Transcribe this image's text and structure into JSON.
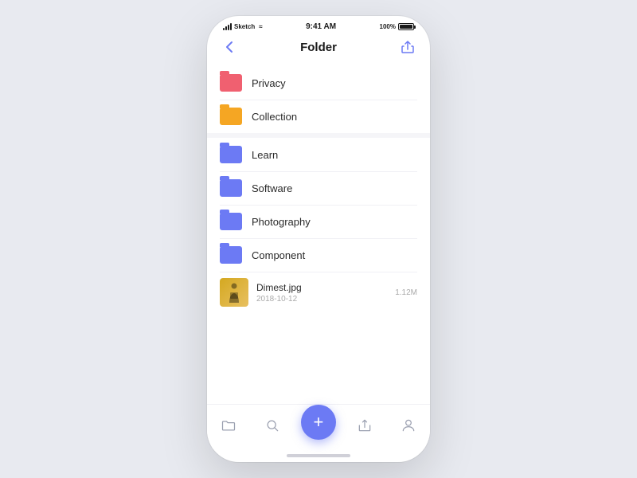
{
  "statusBar": {
    "carrier": "Sketch",
    "time": "9:41 AM",
    "battery": "100%"
  },
  "header": {
    "title": "Folder",
    "backLabel": "‹",
    "shareLabel": "share"
  },
  "sections": [
    {
      "id": "top",
      "items": [
        {
          "id": "privacy",
          "type": "folder",
          "color": "pink",
          "name": "Privacy"
        },
        {
          "id": "collection",
          "type": "folder",
          "color": "yellow",
          "name": "Collection"
        }
      ]
    },
    {
      "id": "main",
      "items": [
        {
          "id": "learn",
          "type": "folder",
          "color": "purple",
          "name": "Learn"
        },
        {
          "id": "software",
          "type": "folder",
          "color": "purple",
          "name": "Software"
        },
        {
          "id": "photography",
          "type": "folder",
          "color": "purple",
          "name": "Photography"
        },
        {
          "id": "component",
          "type": "folder",
          "color": "purple",
          "name": "Component"
        },
        {
          "id": "dimest",
          "type": "file",
          "name": "Dimest.jpg",
          "date": "2018-10-12",
          "size": "1.12M"
        }
      ]
    }
  ],
  "bottomNav": {
    "items": [
      {
        "id": "folder",
        "icon": "folder"
      },
      {
        "id": "search",
        "icon": "search"
      },
      {
        "id": "add",
        "icon": "+"
      },
      {
        "id": "share",
        "icon": "share"
      },
      {
        "id": "user",
        "icon": "user"
      }
    ],
    "fabLabel": "+"
  }
}
